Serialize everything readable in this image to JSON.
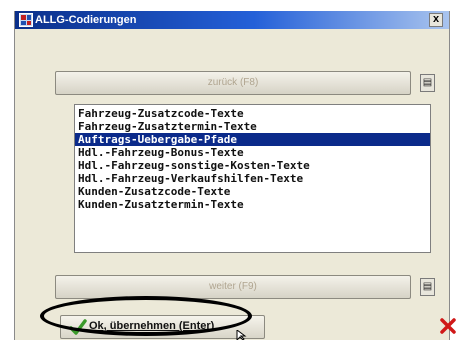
{
  "window": {
    "title": "ALLG-Codierungen",
    "close_label": "x"
  },
  "nav": {
    "back_label": "zurück (F8)",
    "next_label": "weiter (F9)"
  },
  "list": {
    "items": [
      "Fahrzeug-Zusatzcode-Texte",
      "Fahrzeug-Zusatztermin-Texte",
      "Auftrags-Uebergabe-Pfade",
      "Hdl.-Fahrzeug-Bonus-Texte",
      "Hdl.-Fahrzeug-sonstige-Kosten-Texte",
      "Hdl.-Fahrzeug-Verkaufshilfen-Texte",
      "Kunden-Zusatzcode-Texte",
      "Kunden-Zusatztermin-Texte"
    ],
    "selected_index": 2
  },
  "footer": {
    "ok_label": "Ok, übernehmen (Enter)"
  },
  "colors": {
    "title_bar": "#1a4ab8",
    "selection": "#0b2a8a",
    "dialog_bg": "#ece9d8",
    "ok_icon": "#3a9a2a",
    "cancel_icon": "#d01818"
  },
  "icons": {
    "app": "app-grid-icon",
    "close": "close-icon",
    "back_side": "scroll-up-icon",
    "next_side": "scroll-down-icon",
    "ok": "checkmark-icon",
    "cancel": "red-x-icon"
  }
}
